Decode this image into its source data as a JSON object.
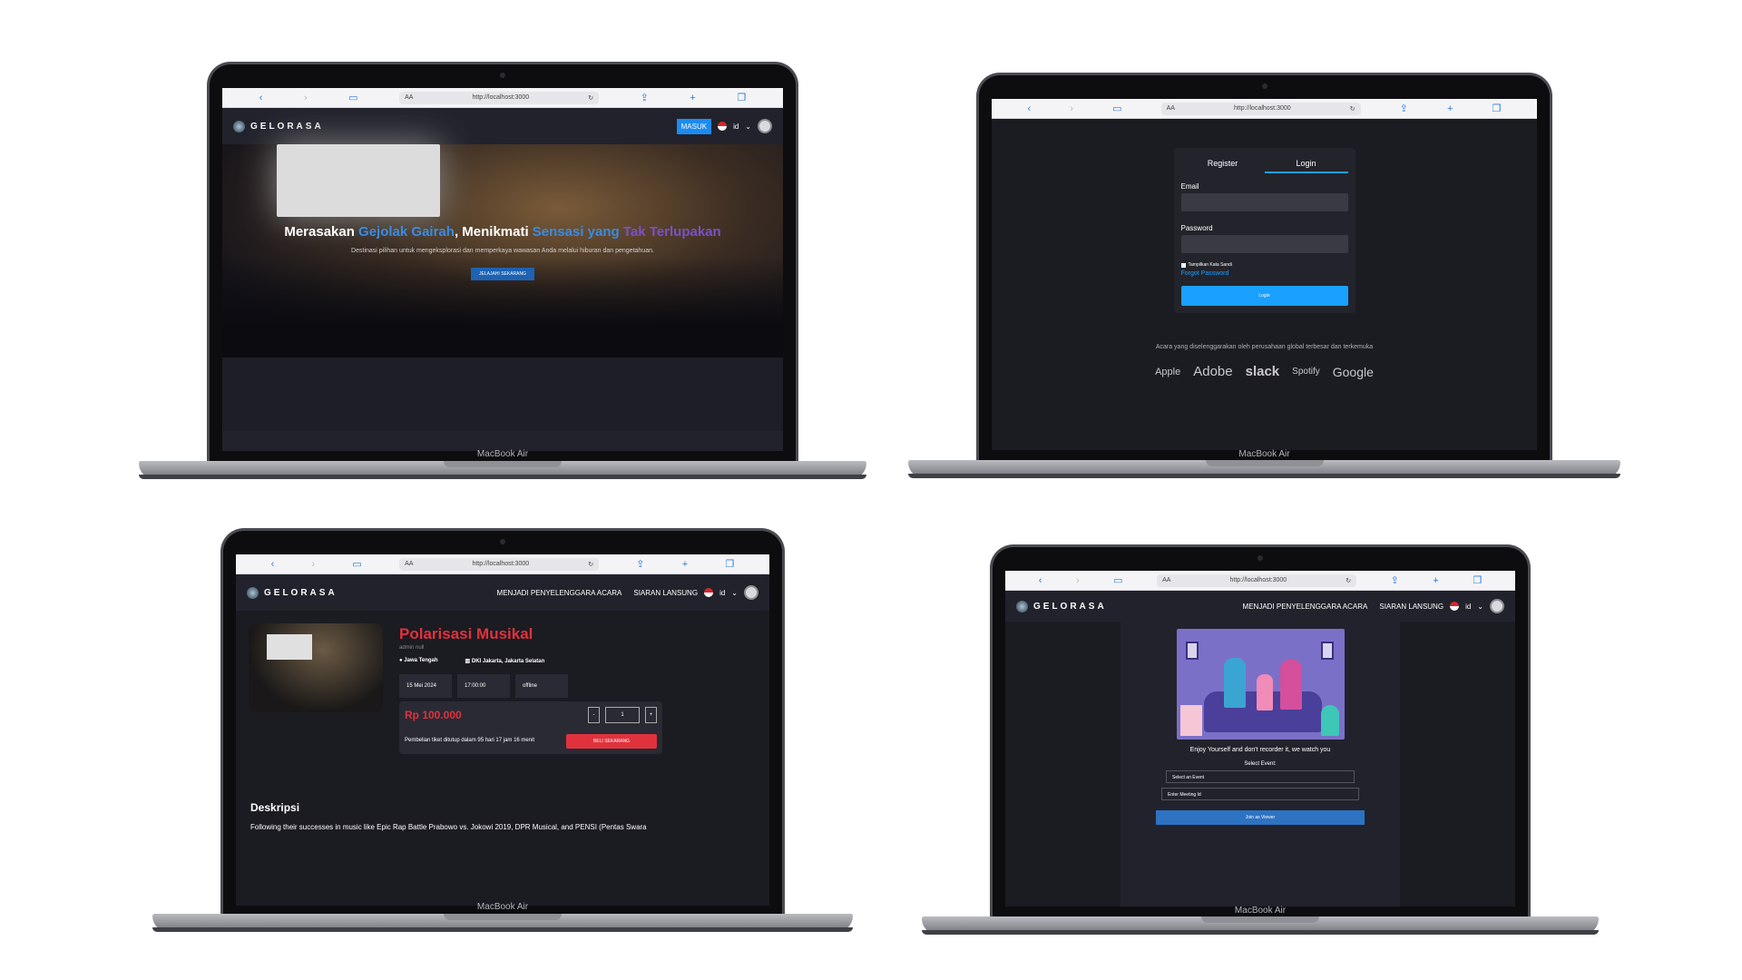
{
  "device_model": "MacBook Air",
  "browser": {
    "text_size": "AA",
    "url": "http://localhost:3000",
    "icons": [
      "back-icon",
      "forward-icon",
      "book-icon",
      "reload-icon",
      "share-icon",
      "plus-icon",
      "tabs-icon"
    ]
  },
  "brand": {
    "name": "GELORASA"
  },
  "nav": {
    "login_button": "MASUK",
    "language": "id",
    "menu_organizer": "MENJADI PENYELENGGARA ACARA",
    "menu_live": "SIARAN LANSUNG"
  },
  "hero": {
    "title_part1": "Merasakan ",
    "title_highlight1": "Gejolak Gairah",
    "title_part2": ", Menikmati ",
    "title_highlight2": "Sensasi yang",
    "title_highlight3": " Tak Terlupakan",
    "subtitle": "Destinasi pilihan untuk mengeksplorasi dan memperkaya wawasan Anda melalui hiburan dan pengetahuan.",
    "cta": "JELAJAHI SEKARANG"
  },
  "auth": {
    "tab_register": "Register",
    "tab_login": "Login",
    "email_label": "Email",
    "password_label": "Password",
    "show_password": "Tampilkan Kata Sandi",
    "forgot": "Forgot Password",
    "submit": "Login",
    "sponsor_text": "Acara yang diselenggarakan oleh perusahaan global terbesar dan terkemuka",
    "brands": [
      "Apple",
      "Adobe",
      "slack",
      "Spotify",
      "Google"
    ]
  },
  "event": {
    "title": "Polarisasi Musikal",
    "organizer": "admin null",
    "province": "Jawa Tengah",
    "city": "DKI Jakarta, Jakarta Selatan",
    "date": "15 Mei 2024",
    "time": "17:00:00",
    "mode": "offline",
    "price": "Rp 100.000",
    "quantity": "1",
    "minus": "-",
    "plus": "+",
    "closing": "Pembelian tiket ditutup dalam 95 hari 17 jam 16 menit",
    "buy": "BELI SEKARANG",
    "desc_heading": "Deskripsi",
    "desc_text": "Following their successes in music like Epic Rap Battle Prabowo vs. Jokowi 2019, DPR Musical, and PENSI (Pentas Swara"
  },
  "watch": {
    "tagline": "Enjoy Yourself and don't recorder it, we watch you",
    "select_label": "Select Event:",
    "select_value": "Select an Event",
    "meeting_placeholder": "Enter Meeting Id",
    "join": "Join as Viewer"
  }
}
